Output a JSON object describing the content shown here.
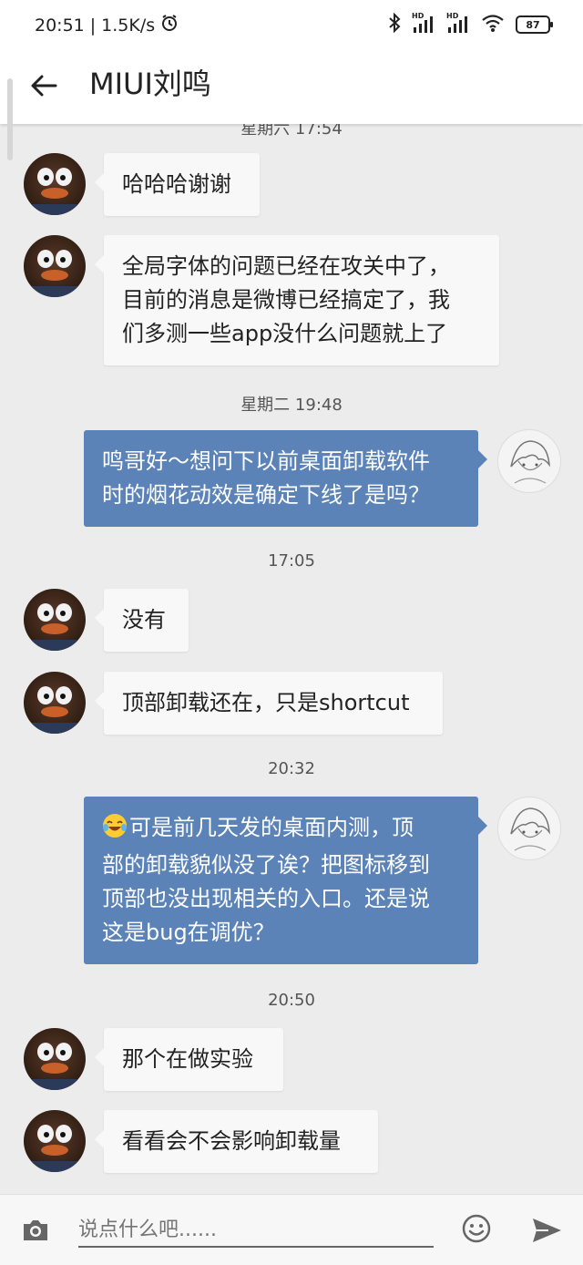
{
  "status_bar": {
    "time": "20:51",
    "network_speed": "1.5K/s",
    "hd1": "HD",
    "hd2": "HD",
    "battery": "87"
  },
  "header": {
    "title": "MIUI刘鸣"
  },
  "timestamps": {
    "t0": "星期六 17:54",
    "t1": "星期二 19:48",
    "t2": "17:05",
    "t3": "20:32",
    "t4": "20:50"
  },
  "messages": {
    "m1": "哈哈哈谢谢",
    "m2": [
      "全局字体的问题已经在攻关中了，",
      "目前的消息是微博已经搞定了，我",
      "们多测一些app没什么问题就上了"
    ],
    "m3": [
      "鸣哥好～想问下以前桌面卸载软件",
      "时的烟花动效是确定下线了是吗？"
    ],
    "m4": "没有",
    "m5": "顶部卸载还在，只是shortcut",
    "m6": [
      "可是前几天发的桌面内测，顶",
      "部的卸载貌似没了诶？把图标移到",
      "顶部也没出现相关的入口。还是说",
      "这是bug在调优？"
    ],
    "m7": "那个在做实验",
    "m8": "看看会不会影响卸载量"
  },
  "input": {
    "placeholder": "说点什么吧......"
  },
  "colors": {
    "outgoing_bubble": "#5b83b8",
    "incoming_bubble": "#f8f8f8",
    "background": "#ececec"
  }
}
